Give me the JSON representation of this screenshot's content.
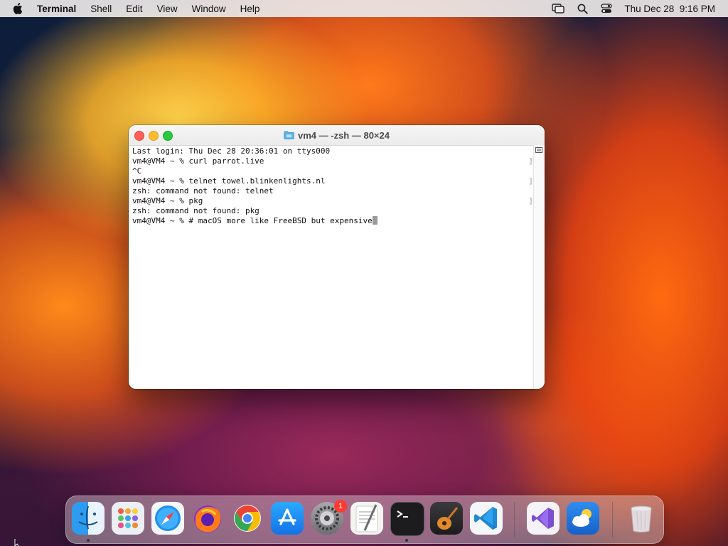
{
  "menubar": {
    "app_name": "Terminal",
    "items": [
      "Shell",
      "Edit",
      "View",
      "Window",
      "Help"
    ],
    "clock": "Thu Dec 28  9:16 PM"
  },
  "window": {
    "title": "vm4 — -zsh — 80×24",
    "lines": [
      "Last login: Thu Dec 28 20:36:01 on ttys000",
      "vm4@VM4 ~ % curl parrot.live",
      "^C",
      "vm4@VM4 ~ % telnet towel.blinkenlights.nl",
      "zsh: command not found: telnet",
      "vm4@VM4 ~ % pkg",
      "zsh: command not found: pkg",
      "vm4@VM4 ~ % # macOS more like FreeBSD but expensive"
    ]
  },
  "dock": {
    "apps": [
      "finder",
      "launchpad",
      "safari",
      "firefox",
      "chrome",
      "app-store",
      "system-settings",
      "textedit",
      "terminal",
      "garageband",
      "vscode",
      "visual-studio",
      "weather",
      "trash"
    ],
    "system_settings_badge": "1"
  }
}
